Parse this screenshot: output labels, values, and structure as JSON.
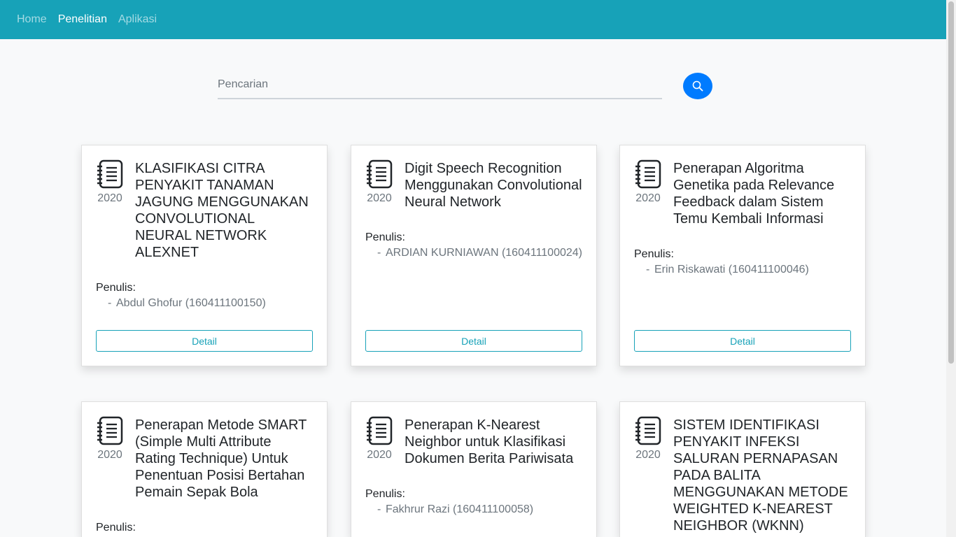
{
  "nav": {
    "items": [
      {
        "label": "Home",
        "active": false
      },
      {
        "label": "Penelitian",
        "active": true
      },
      {
        "label": "Aplikasi",
        "active": false
      }
    ]
  },
  "search": {
    "placeholder": "Pencarian",
    "value": ""
  },
  "authors_label": "Penulis:",
  "detail_label": "Detail",
  "author_dash": "-",
  "colors": {
    "navbar": "#17a2b8",
    "search_button": "#007bff",
    "detail_outline": "#17a2b8"
  },
  "cards": [
    {
      "year": "2020",
      "title": "KLASIFIKASI CITRA PENYAKIT TANAMAN JAGUNG MENGGUNAKAN CONVOLUTIONAL NEURAL NETWORK ALEXNET",
      "authors": [
        "Abdul Ghofur (160411100150)"
      ]
    },
    {
      "year": "2020",
      "title": "Digit Speech Recognition Menggunakan Convolutional Neural Network",
      "authors": [
        "ARDIAN KURNIAWAN (160411100024)"
      ]
    },
    {
      "year": "2020",
      "title": "Penerapan Algoritma Genetika pada Relevance Feedback dalam Sistem Temu Kembali Informasi",
      "authors": [
        "Erin Riskawati (160411100046)"
      ]
    },
    {
      "year": "2020",
      "title": "Penerapan Metode SMART (Simple Multi Attribute Rating Technique) Untuk Penentuan Posisi Bertahan Pemain Sepak Bola",
      "authors": []
    },
    {
      "year": "2020",
      "title": "Penerapan K-Nearest Neighbor untuk Klasifikasi Dokumen Berita Pariwisata",
      "authors": [
        "Fakhrur Razi (160411100058)"
      ]
    },
    {
      "year": "2020",
      "title": "SISTEM IDENTIFIKASI PENYAKIT INFEKSI SALURAN PERNAPASAN PADA BALITA MENGGUNAKAN METODE WEIGHTED K-NEAREST NEIGHBOR (WKNN)",
      "authors": []
    }
  ]
}
